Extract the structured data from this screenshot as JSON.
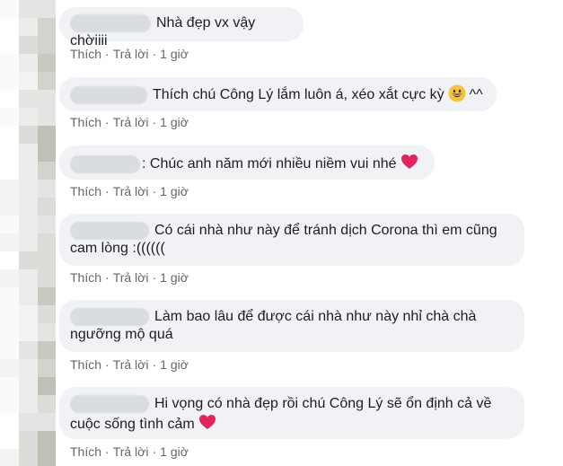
{
  "comments": [
    {
      "text": "Nhà đẹp vx vậy chờiiii",
      "actions": {
        "like": "Thích",
        "reply": "Trả lời",
        "time": "1 giờ"
      }
    },
    {
      "text": "Thích chú Công Lý lắm luôn á, xéo xắt cực kỳ",
      "text_after": "^^",
      "emoji": "grinning-face",
      "actions": {
        "like": "Thích",
        "reply": "Trả lời",
        "time": "1 giờ"
      }
    },
    {
      "text": ": Chúc anh năm mới nhiều niềm vui nhé",
      "emoji": "red-heart",
      "actions": {
        "like": "Thích",
        "reply": "Trả lời",
        "time": "1 giờ"
      }
    },
    {
      "line1": "Có cái nhà như này để tránh dịch Corona thì em cũng",
      "line2": "cam lòng :((((((",
      "actions": {
        "like": "Thích",
        "reply": "Trả lời",
        "time": "1 giờ"
      }
    },
    {
      "line1": "Làm bao lâu để được cái nhà như này nhỉ chà chà",
      "line2": "ngưỡng mộ quá",
      "actions": {
        "like": "Thích",
        "reply": "Trả lời",
        "time": "1 giờ"
      }
    },
    {
      "line1": "Hi vọng có nhà đẹp rồi chú Công Lý sẽ ổn định cả về",
      "line2": "cuộc sống tình cảm",
      "emoji": "red-heart",
      "actions": {
        "like": "Thích",
        "reply": "Trả lời",
        "time": "1 giờ"
      }
    }
  ],
  "separator": "·",
  "colors": {
    "bubble": "#f0f2f5",
    "text": "#1c1e21",
    "meta": "#65676b",
    "heart": "#e0245e"
  }
}
